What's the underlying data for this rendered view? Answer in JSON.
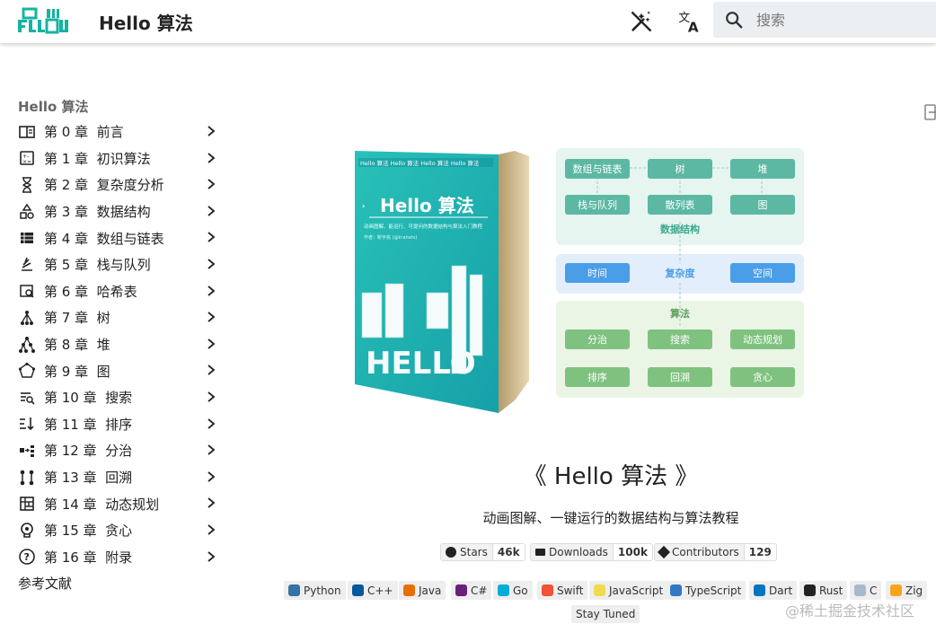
{
  "header": {
    "title": "Hello 算法",
    "search_placeholder": "搜索"
  },
  "nav": {
    "title": "Hello 算法",
    "items": [
      {
        "label": "第 0 章  前言",
        "icon": "book-open-icon"
      },
      {
        "label": "第 1 章  初识算法",
        "icon": "calculator-icon"
      },
      {
        "label": "第 2 章  复杂度分析",
        "icon": "hourglass-icon"
      },
      {
        "label": "第 3 章  数据结构",
        "icon": "shapes-icon"
      },
      {
        "label": "第 4 章  数组与链表",
        "icon": "table-icon"
      },
      {
        "label": "第 5 章  栈与队列",
        "icon": "stack-icon"
      },
      {
        "label": "第 6 章  哈希表",
        "icon": "hash-table-icon"
      },
      {
        "label": "第 7 章  树",
        "icon": "tree-icon"
      },
      {
        "label": "第 8 章  堆",
        "icon": "heap-icon"
      },
      {
        "label": "第 9 章  图",
        "icon": "graph-icon"
      },
      {
        "label": "第 10 章  搜索",
        "icon": "search-list-icon"
      },
      {
        "label": "第 11 章  排序",
        "icon": "sort-icon"
      },
      {
        "label": "第 12 章  分治",
        "icon": "divide-icon"
      },
      {
        "label": "第 13 章  回溯",
        "icon": "backtrack-icon"
      },
      {
        "label": "第 14 章  动态规划",
        "icon": "grid-icon"
      },
      {
        "label": "第 15 章  贪心",
        "icon": "lightbulb-icon"
      },
      {
        "label": "第 16 章  附录",
        "icon": "help-circle-icon"
      }
    ],
    "references": "参考文献"
  },
  "hero": {
    "book_logo_text": "HELLO",
    "book_title": "Hello 算法",
    "book_subtitle": "动画图解、能运行、可提问的数据结构与算法入门教程",
    "book_author": "作者：靳宇栋 (@krahets)",
    "book_banner": "Hello 算法 Hello 算法 Hello 算法 Hello 算法",
    "diagram": {
      "ds_nodes": [
        "数组与链表",
        "树",
        "堆",
        "栈与队列",
        "散列表",
        "图"
      ],
      "ds_label": "数据结构",
      "cx_nodes": [
        "时间",
        "复杂度",
        "空间"
      ],
      "algo_label": "算法",
      "algo_nodes": [
        "分治",
        "搜索",
        "动态规划",
        "排序",
        "回溯",
        "贪心"
      ]
    }
  },
  "main": {
    "title": "《 Hello 算法 》",
    "subtitle": "动画图解、一键运行的数据结构与算法教程",
    "badges": [
      {
        "label": "Stars",
        "value": "46k"
      },
      {
        "label": "Downloads",
        "value": "100k"
      },
      {
        "label": "Contributors",
        "value": "129"
      }
    ],
    "languages": [
      "Python",
      "C++",
      "Java",
      "C#",
      "Go",
      "Swift",
      "JavaScript",
      "TypeScript",
      "Dart",
      "Rust",
      "C",
      "Zig"
    ],
    "stay_tuned": "Stay Tuned"
  },
  "watermark": "@稀土掘金技术社区",
  "colors": {
    "brand_teal": "#1fb5a4",
    "ds_green": "#5cb8a3",
    "cx_blue": "#4a9ee8",
    "algo_green": "#7fc27f"
  }
}
